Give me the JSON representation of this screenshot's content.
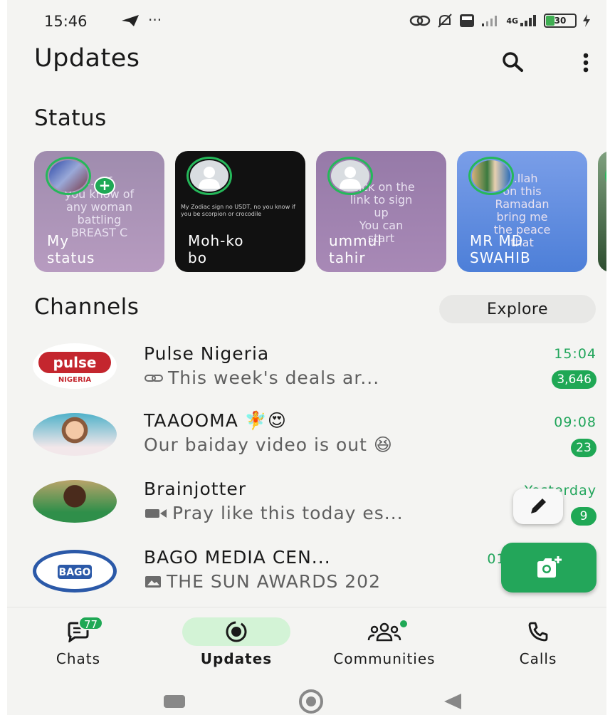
{
  "status_bar": {
    "time": "15:46",
    "more": "···",
    "network_label": "4G",
    "battery_level": "30"
  },
  "header": {
    "title": "Updates",
    "search_icon": "search-icon",
    "menu_icon": "more-vert-icon"
  },
  "status": {
    "section_title": "Status",
    "items": [
      {
        "name": "My\nstatus",
        "preview": "..., if\nyou know of\nany woman\nbattling\nBREAST C",
        "bg": "#a68fae"
      },
      {
        "name": "Moh-ko\nbo",
        "preview": "My Zodiac sign no USDT, no you know if you be scorpion or crocodile",
        "bg": "#111111"
      },
      {
        "name": "ummul\ntahir",
        "preview": "Click on the\nlink to sign\nup\nYou can\nstart",
        "bg": "#9d80ad"
      },
      {
        "name": "MR MD\nSWAHIB",
        "preview": "...llah\non this\nRamadan\nbring me\nthe peace\nthat",
        "bg": "#5f8ee0"
      }
    ]
  },
  "channels": {
    "section_title": "Channels",
    "explore_label": "Explore",
    "items": [
      {
        "name": "Pulse Nigeria",
        "message": "This week's deals ar...",
        "time": "15:04",
        "unread": "3,646",
        "msg_icon": "link-icon"
      },
      {
        "name": "TAAOOMA 🧚😍",
        "message": "Our baiday video is out 😆",
        "time": "09:08",
        "unread": "23",
        "msg_icon": ""
      },
      {
        "name": "Brainjotter",
        "message": "Pray like this today es...",
        "time": "Yesterday",
        "unread": "9",
        "msg_icon": "video-icon"
      },
      {
        "name": "BAGO MEDIA CEN...",
        "message": "THE SUN AWARDS 202",
        "time": "01/",
        "unread": "",
        "msg_icon": "image-icon"
      }
    ],
    "pulse_logo_text": "pulse",
    "pulse_logo_sub": "NIGERIA",
    "bago_logo_text": "BAGO"
  },
  "bottom_nav": {
    "items": [
      {
        "label": "Chats",
        "badge": "77",
        "icon": "chats-icon"
      },
      {
        "label": "Updates",
        "icon": "updates-icon",
        "active": true
      },
      {
        "label": "Communities",
        "icon": "communities-icon"
      },
      {
        "label": "Calls",
        "icon": "calls-icon"
      }
    ]
  },
  "colors": {
    "accent_green": "#1fa855",
    "background": "#f4f4f2",
    "active_pill": "#d3f3d6"
  }
}
